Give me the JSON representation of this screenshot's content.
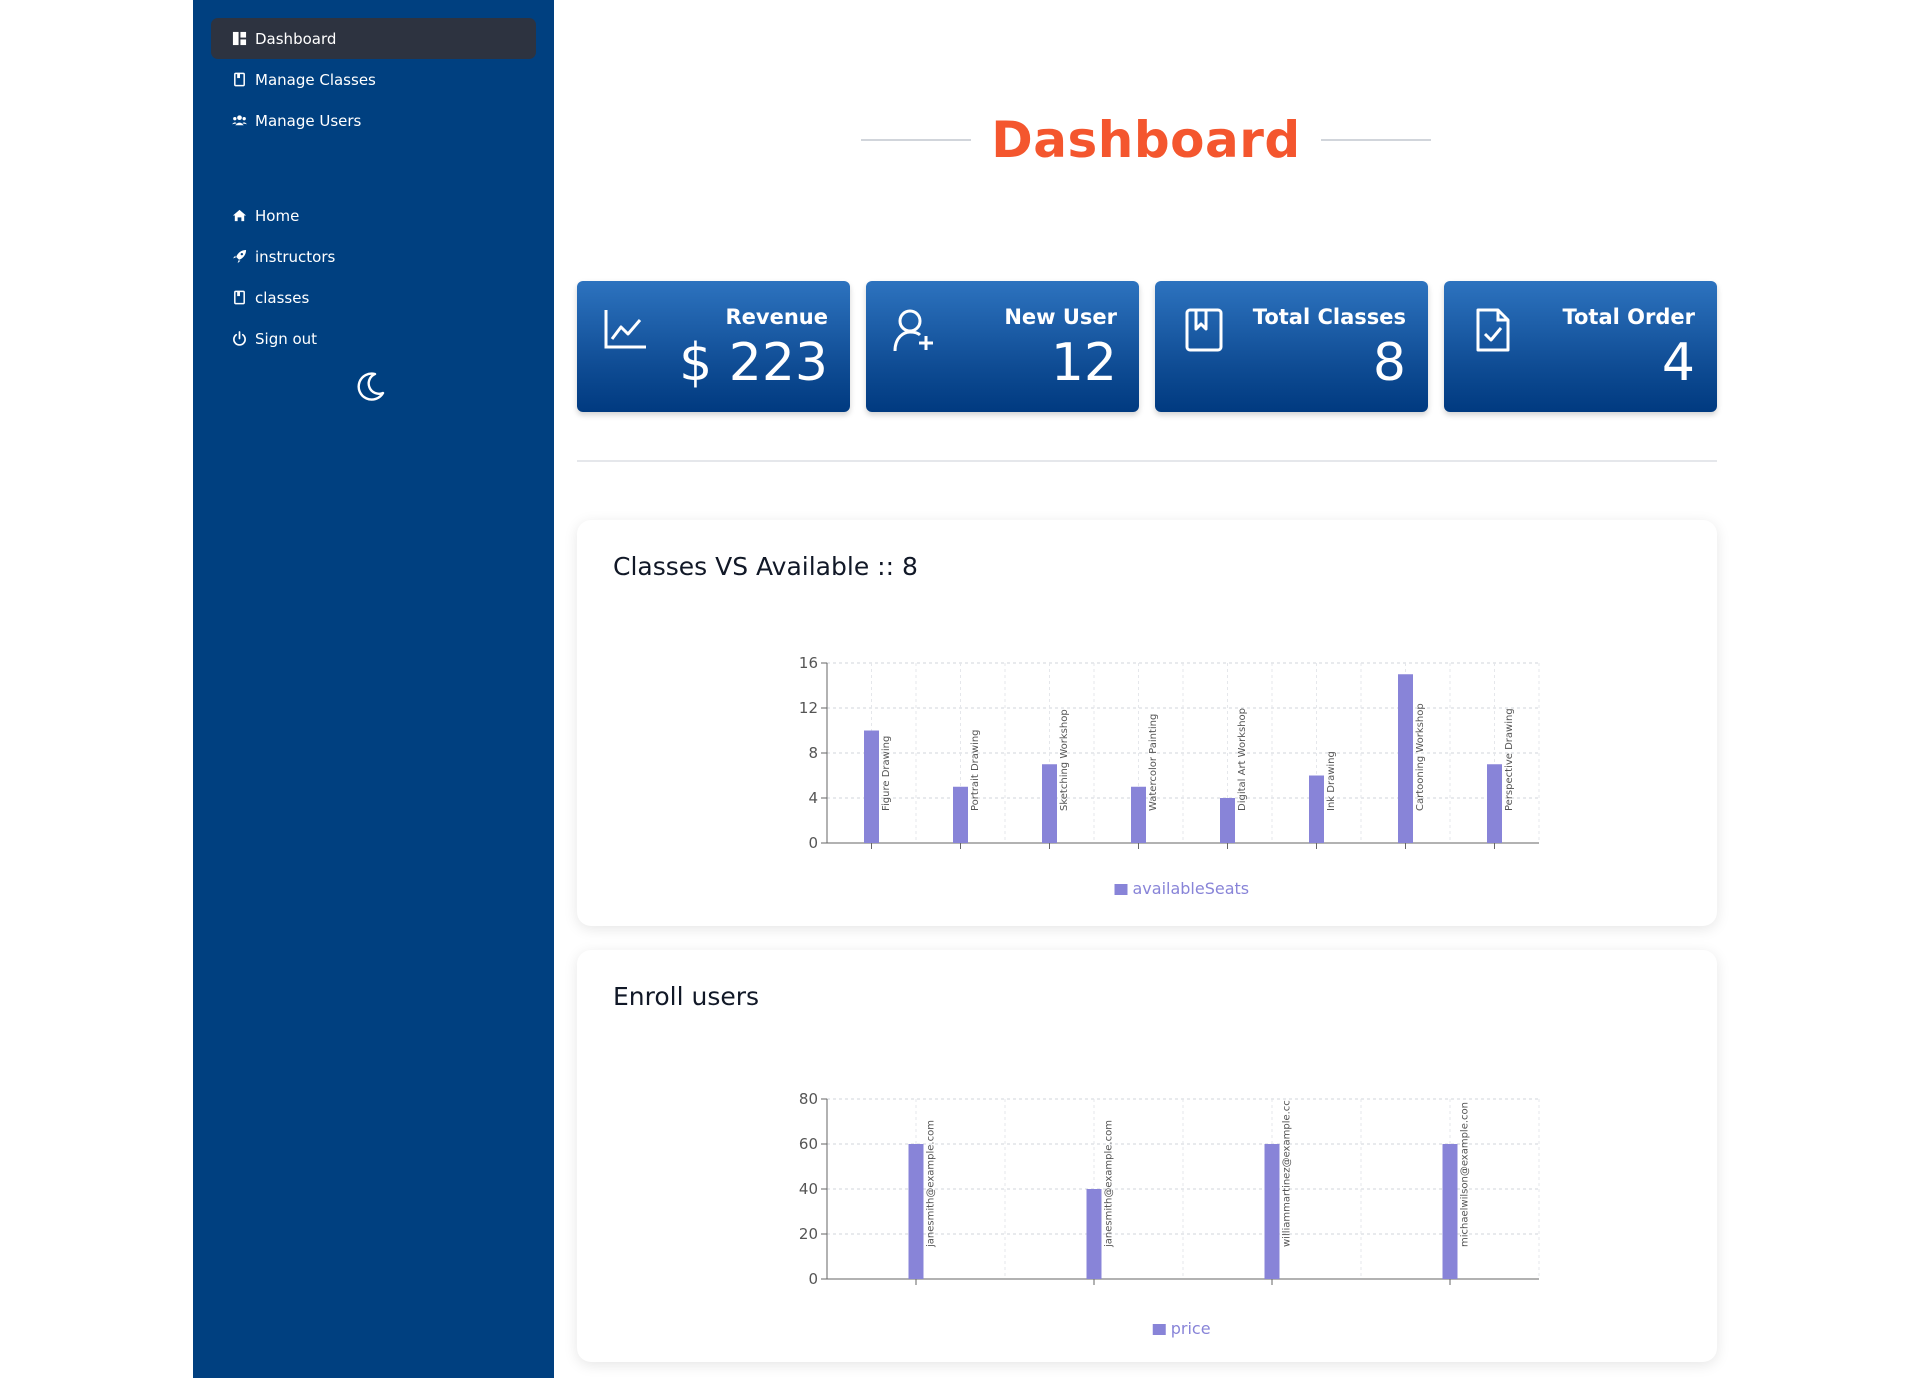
{
  "sidebar": {
    "top_items": [
      {
        "label": "Dashboard",
        "icon": "dashboard-icon",
        "active": true
      },
      {
        "label": "Manage Classes",
        "icon": "book-icon"
      },
      {
        "label": "Manage Users",
        "icon": "users-icon"
      }
    ],
    "bottom_items": [
      {
        "label": "Home",
        "icon": "home-icon"
      },
      {
        "label": "instructors",
        "icon": "rocket-icon"
      },
      {
        "label": "classes",
        "icon": "book-icon"
      },
      {
        "label": "Sign out",
        "icon": "power-icon"
      }
    ],
    "theme_toggle_icon": "moon-icon",
    "color": "#004080"
  },
  "main": {
    "title": "Dashboard",
    "title_color": "#f4562e",
    "cards": [
      {
        "label": "Revenue",
        "value": "$ 223",
        "icon": "chart-line-icon"
      },
      {
        "label": "New User",
        "value": "12",
        "icon": "user-plus-icon"
      },
      {
        "label": "Total Classes",
        "value": "8",
        "icon": "bookmark-book-icon"
      },
      {
        "label": "Total Order",
        "value": "4",
        "icon": "file-check-icon"
      }
    ],
    "panels": [
      {
        "title": "Classes VS Available :: 8"
      },
      {
        "title": "Enroll users"
      }
    ]
  },
  "chart_data": [
    {
      "type": "bar",
      "categories": [
        "Figure Drawing",
        "Portrait Drawing",
        "Sketching Workshop",
        "Watercolor Painting",
        "Digital Art Workshop",
        "Ink Drawing",
        "Cartooning Workshop",
        "Perspective Drawing"
      ],
      "series": [
        {
          "name": "availableSeats",
          "values": [
            10,
            5,
            7,
            5,
            4,
            6,
            15,
            7
          ]
        }
      ],
      "ylim": [
        0,
        16
      ],
      "yticks": [
        0,
        4,
        8,
        12,
        16
      ],
      "grid": true,
      "legend": "bottom",
      "bar_color": "#8884d8"
    },
    {
      "type": "bar",
      "categories": [
        "janesmith@example.com",
        "janesmith@example.com",
        "williammartinez@example.cc",
        "michaelwilson@example.con"
      ],
      "series": [
        {
          "name": "price",
          "values": [
            60,
            40,
            60,
            60
          ]
        }
      ],
      "ylim": [
        0,
        80
      ],
      "yticks": [
        0,
        20,
        40,
        60,
        80
      ],
      "grid": true,
      "legend": "bottom",
      "bar_color": "#8884d8"
    }
  ]
}
